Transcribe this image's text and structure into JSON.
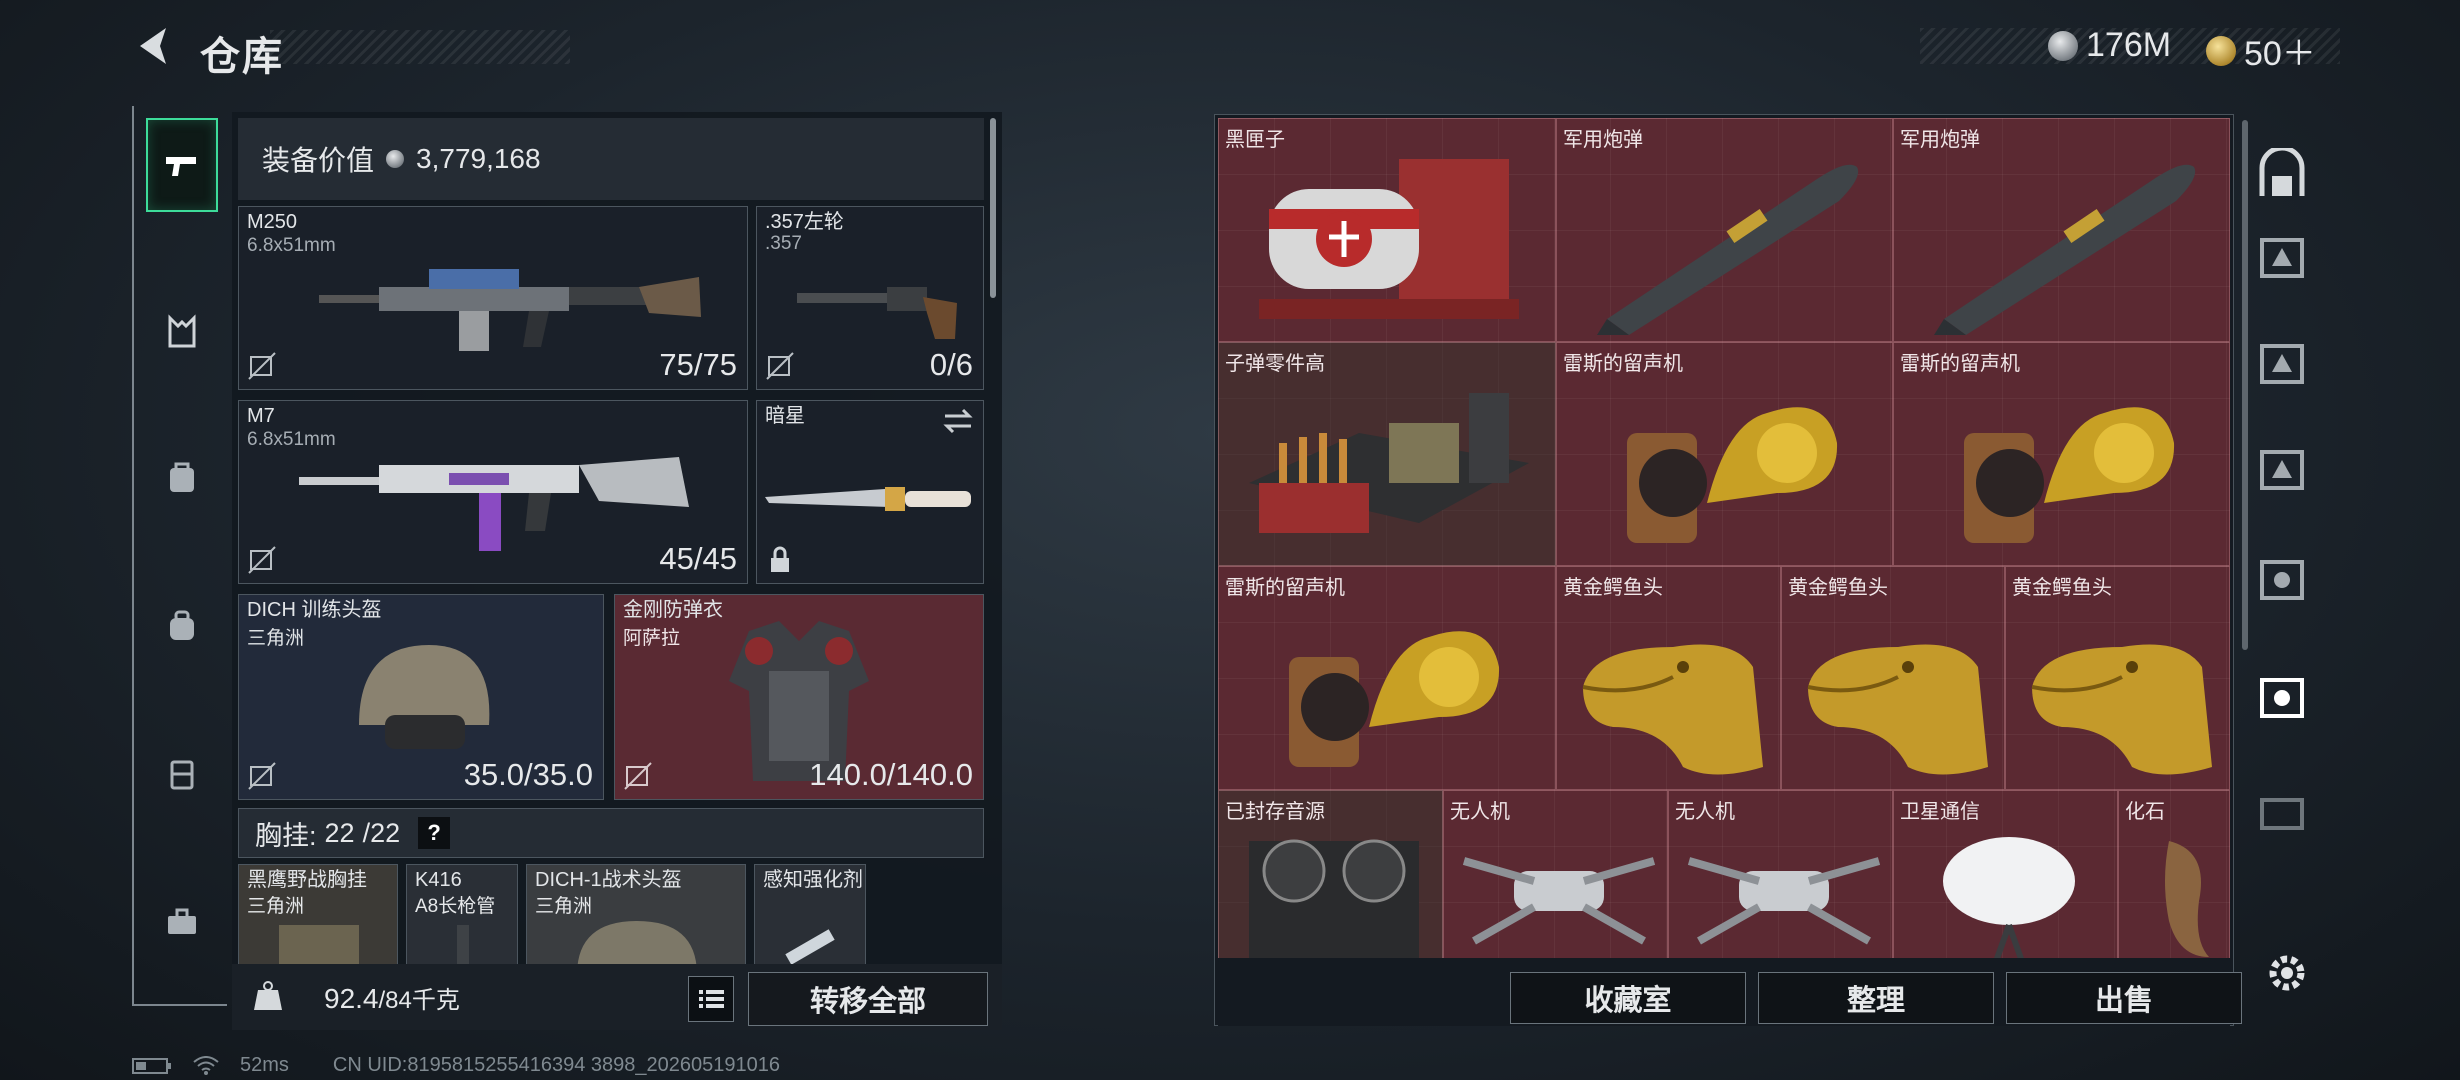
{
  "header": {
    "title": "仓库",
    "currency_silver": "176M",
    "currency_gold": "50＋"
  },
  "nav": {
    "items": [
      "firearm-icon",
      "vest-icon",
      "backpack-armor-icon",
      "backpack-icon",
      "case-icon",
      "toolbox-icon"
    ]
  },
  "equipment": {
    "value_label": "装备价值",
    "value": "3,779,168",
    "slots": [
      {
        "name": "M250",
        "sub": "6.8x51mm",
        "count": "75/75"
      },
      {
        "name": ".357左轮",
        "sub": ".357",
        "count": "0/6"
      },
      {
        "name": "M7",
        "sub": "6.8x51mm",
        "count": "45/45"
      },
      {
        "name": "暗星",
        "sub": "",
        "count": ""
      },
      {
        "name": "DICH 训练头盔",
        "sub": "三角洲",
        "count": "35.0/35.0"
      },
      {
        "name": "金刚防弹衣",
        "sub": "阿萨拉",
        "count": "140.0/140.0"
      }
    ],
    "chest_label": "胸挂:",
    "chest_count": "22",
    "chest_total": "/22",
    "chest_help": "?",
    "chest_items": [
      {
        "name": "黑鹰野战胸挂",
        "sub": "三角洲"
      },
      {
        "name": "K416",
        "sub": "A8长枪管"
      },
      {
        "name": "DICH-1战术头盔",
        "sub": "三角洲"
      },
      {
        "name": "感知强化剂",
        "sub": ""
      }
    ]
  },
  "weight": {
    "current": "92.4",
    "max": "/84千克"
  },
  "buttons": {
    "transfer_all": "转移全部",
    "collection": "收藏室",
    "organize": "整理",
    "sell": "出售"
  },
  "storage": {
    "items": [
      {
        "name": "黑匣子",
        "icon": "black-box-icon"
      },
      {
        "name": "军用炮弹",
        "icon": "missile-icon"
      },
      {
        "name": "军用炮弹",
        "icon": "missile-icon"
      },
      {
        "name": "子弹零件高",
        "icon": "ammo-crate-icon"
      },
      {
        "name": "雷斯的留声机",
        "icon": "gramophone-icon"
      },
      {
        "name": "雷斯的留声机",
        "icon": "gramophone-icon"
      },
      {
        "name": "雷斯的留声机",
        "icon": "gramophone-icon"
      },
      {
        "name": "黄金鳄鱼头",
        "icon": "gold-crocodile-icon"
      },
      {
        "name": "黄金鳄鱼头",
        "icon": "gold-crocodile-icon"
      },
      {
        "name": "黄金鳄鱼头",
        "icon": "gold-crocodile-icon"
      },
      {
        "name": "已封存音源",
        "icon": "tape-recorder-icon"
      },
      {
        "name": "无人机",
        "icon": "drone-icon"
      },
      {
        "name": "无人机",
        "icon": "drone-icon"
      },
      {
        "name": "卫星通信",
        "icon": "satellite-dish-icon"
      },
      {
        "name": "化石",
        "icon": "fossil-icon"
      }
    ]
  },
  "status": {
    "ping": "52ms",
    "uid": "CN UID:8195815255416394 3898_202605191016"
  },
  "colors": {
    "accent": "#3ddc9a",
    "storage_bg": "#522a31",
    "panel": "#12181f"
  }
}
